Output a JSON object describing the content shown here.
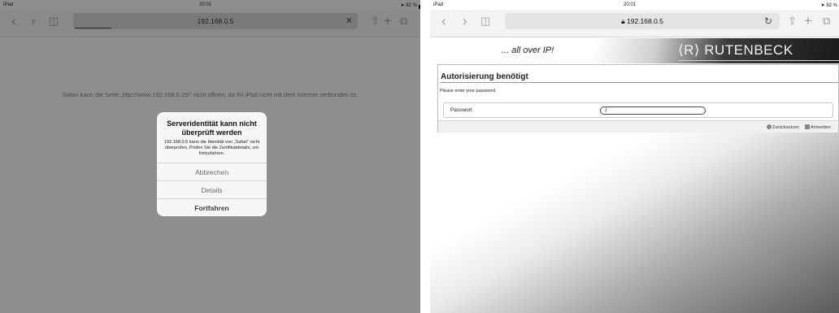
{
  "left": {
    "status": {
      "device": "iPad",
      "time": "20:01",
      "battery": "82 %"
    },
    "toolbar": {
      "address": "192.168.0.5",
      "clear_icon": "✕"
    },
    "page": {
      "error_message": "Safari kann die Seite „http://www.192.168.0.25/“ nicht öffnen, da Ihr iPad nicht mit dem Internet verbunden ist."
    },
    "dialog": {
      "title": "Serveridentität kann nicht überprüft werden",
      "body": "192.168.0.5 kann die Identität von „Safari“ nicht überprüfen. Prüfen Sie die Zertifikatdetails, um fortzufahren.",
      "buttons": {
        "cancel": "Abbrechen",
        "details": "Details",
        "continue": "Fortfahren"
      }
    }
  },
  "right": {
    "status": {
      "device": "iPad",
      "time": "20:01",
      "battery": "82 %"
    },
    "toolbar": {
      "address": "192.168.0.5"
    },
    "banner": {
      "tagline": "... all over IP!",
      "brand": "⟨R⟩ RUTENBECK"
    },
    "auth": {
      "title": "Autorisierung benötigt",
      "prompt": "Please enter your password.",
      "password_label": "Passwort",
      "password_value": "",
      "reset_label": "Zurücksetzen",
      "login_label": "Anmelden"
    }
  }
}
